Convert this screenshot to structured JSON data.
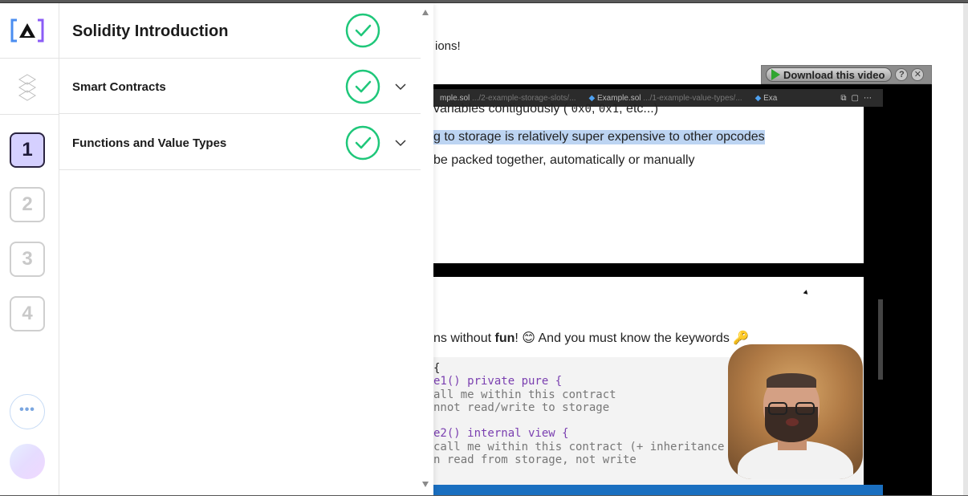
{
  "background": {
    "partial_text": "ions!",
    "download_bar": {
      "label": "Download this video",
      "help": "?",
      "close": "✕"
    },
    "video": {
      "tabs": [
        {
          "name": "mple.sol",
          "path": ".../2-example-storage-slots/..."
        },
        {
          "name": "Example.sol",
          "path": ".../1-example-value-types/..."
        },
        {
          "name": "Exa",
          "path": ""
        }
      ],
      "slide1": {
        "line1_pre": "variables contiguously (",
        "line1_code1": "0x0",
        "line1_sep": ",",
        "line1_code2": "0x1",
        "line1_post": ", etc...)",
        "line2": "g to storage is relatively super expensive to other opcodes",
        "line3": "be packed together, automatically or manually"
      },
      "slide2": {
        "heading_pre": "ns without ",
        "heading_bold": "fun",
        "heading_post": "! 😊 And you must know the keywords 🔑",
        "code": [
          {
            "text": "{",
            "kind": "plain"
          },
          {
            "text": "e1() private pure {",
            "kind": "fn"
          },
          {
            "text": "all me within this contract",
            "kind": "comment"
          },
          {
            "text": "nnot read/write to storage",
            "kind": "comment"
          },
          {
            "text": "",
            "kind": "plain"
          },
          {
            "text": "e2() internal view {",
            "kind": "fn"
          },
          {
            "text": "call me within this contract (+ inheritance",
            "kind": "comment"
          },
          {
            "text": "n read from storage, not write",
            "kind": "comment"
          }
        ]
      }
    }
  },
  "panel": {
    "sections": [
      {
        "title": "Solidity Introduction",
        "completed": true,
        "expandable": false
      },
      {
        "title": "Smart Contracts",
        "completed": true,
        "expandable": true
      },
      {
        "title": "Functions and Value Types",
        "completed": true,
        "expandable": true
      }
    ],
    "rail_numbers": [
      "1",
      "2",
      "3",
      "4"
    ],
    "active_number": "1",
    "more_label": "•••"
  },
  "colors": {
    "check": "#1fc77a",
    "active_bg": "#d5d0ff",
    "logo_blue": "#4a8df0",
    "logo_purple": "#8b5cf6"
  }
}
